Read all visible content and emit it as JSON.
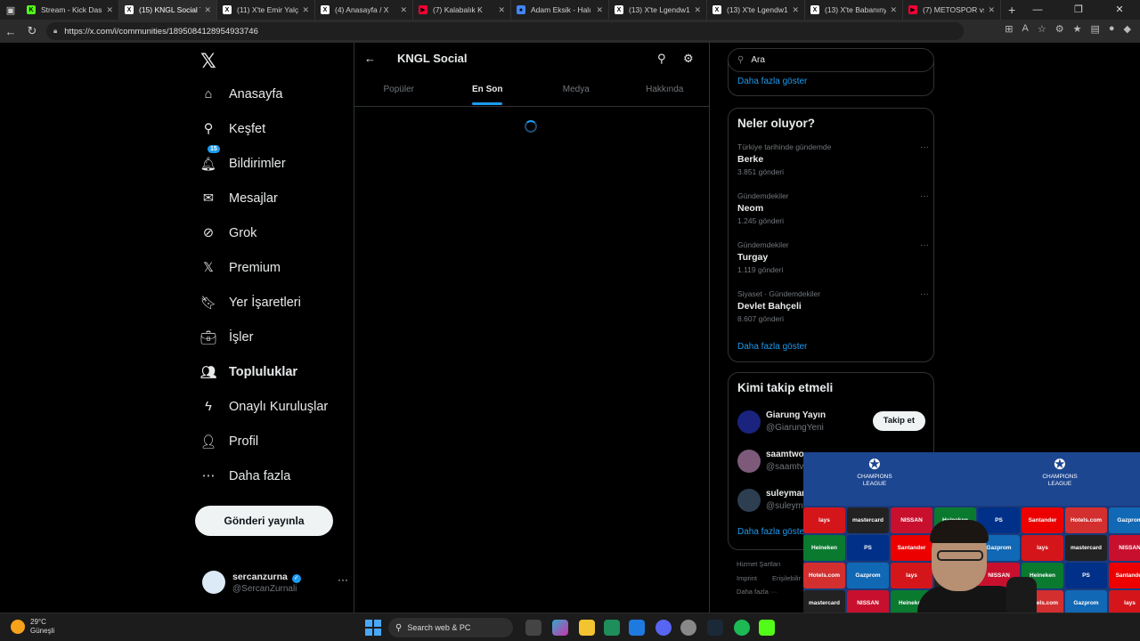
{
  "browser": {
    "tabs": [
      {
        "label": "Stream - Kick Dashb",
        "color": "#53fc18",
        "fav": "K"
      },
      {
        "label": "(15) KNGL Social To",
        "color": "#ffffff",
        "fav": "X",
        "active": true
      },
      {
        "label": "(11) X'te Emir Yalçın",
        "color": "#ffffff",
        "fav": "X"
      },
      {
        "label": "(4) Anasayfa / X",
        "color": "#ffffff",
        "fav": "X"
      },
      {
        "label": "(7) Kalabalık K",
        "color": "#ff0033",
        "fav": "▶"
      },
      {
        "label": "Adam Eksik - Halı s",
        "color": "#4285f4",
        "fav": "●"
      },
      {
        "label": "(13) X'te Lgendw1:",
        "color": "#ffffff",
        "fav": "X"
      },
      {
        "label": "(13) X'te Lgendw1:",
        "color": "#ffffff",
        "fav": "X"
      },
      {
        "label": "(13) X'te Babanıny",
        "color": "#ffffff",
        "fav": "X"
      },
      {
        "label": "(7) METOSPOR vs K",
        "color": "#ff0033",
        "fav": "▶"
      }
    ],
    "url": "https://x.com/i/communities/1895084128954933746"
  },
  "nav": {
    "items": [
      {
        "label": "Anasayfa",
        "icon": "home-icon",
        "glyph": "⌂"
      },
      {
        "label": "Keşfet",
        "icon": "search-icon",
        "glyph": "⚲"
      },
      {
        "label": "Bildirimler",
        "icon": "bell-icon",
        "glyph": "🔔︎",
        "badge": "15"
      },
      {
        "label": "Mesajlar",
        "icon": "mail-icon",
        "glyph": "✉"
      },
      {
        "label": "Grok",
        "icon": "grok-icon",
        "glyph": "⊘"
      },
      {
        "label": "Premium",
        "icon": "x-premium-icon",
        "glyph": "𝕏"
      },
      {
        "label": "Yer İşaretleri",
        "icon": "bookmark-icon",
        "glyph": "🔖︎"
      },
      {
        "label": "İşler",
        "icon": "briefcase-icon",
        "glyph": "💼︎"
      },
      {
        "label": "Topluluklar",
        "icon": "communities-icon",
        "glyph": "👥︎",
        "bold": true
      },
      {
        "label": "Onaylı Kuruluşlar",
        "icon": "lightning-icon",
        "glyph": "ϟ"
      },
      {
        "label": "Profil",
        "icon": "profile-icon",
        "glyph": "👤︎"
      },
      {
        "label": "Daha fazla",
        "icon": "more-circle-icon",
        "glyph": "⋯"
      }
    ],
    "post_button": "Gönderi yayınla",
    "profile": {
      "name": "sercanzurna",
      "handle": "@SercanZurnali"
    }
  },
  "main": {
    "title": "KNGL Social",
    "tabs": [
      "Popüler",
      "En Son",
      "Medya",
      "Hakkında"
    ],
    "active_tab": "En Son"
  },
  "right": {
    "search_placeholder": "Ara",
    "prev_show_more": "Daha fazla göster",
    "trends_title": "Neler oluyor?",
    "trends": [
      {
        "meta": "Türkiye tarihinde gündemde",
        "name": "Berke",
        "count": "3.851 gönderi"
      },
      {
        "meta": "Gündemdekiler",
        "name": "Neom",
        "count": "1.245 gönderi"
      },
      {
        "meta": "Gündemdekiler",
        "name": "Turgay",
        "count": "1.119 gönderi"
      },
      {
        "meta": "Siyaset · Gündemdekiler",
        "name": "Devlet Bahçeli",
        "count": "8.607 gönderi"
      }
    ],
    "trends_show_more": "Daha fazla göster",
    "follow_title": "Kimi takip etmeli",
    "follow": [
      {
        "name": "Giarung Yayın",
        "handle": "@GiarungYeni",
        "btn": "Takip et"
      },
      {
        "name": "saamtwo",
        "handle": "@saamtv"
      },
      {
        "name": "suleyman",
        "handle": "@suleym"
      }
    ],
    "follow_show_more": "Daha fazla göster",
    "footer": [
      "Hizmet Şartları",
      "Imprint",
      "Erişilebilir",
      "Daha fazla ···"
    ]
  },
  "overlay": {
    "league_logo": "CHAMPIONS LEAGUE",
    "sponsors": [
      "lays",
      "mastercard",
      "NISSAN",
      "Heineken",
      "PS",
      "Santander",
      "Hotels.com",
      "Gazprom"
    ]
  },
  "taskbar": {
    "temp": "29°C",
    "weather": "Güneşli",
    "search": "Search web & PC"
  }
}
